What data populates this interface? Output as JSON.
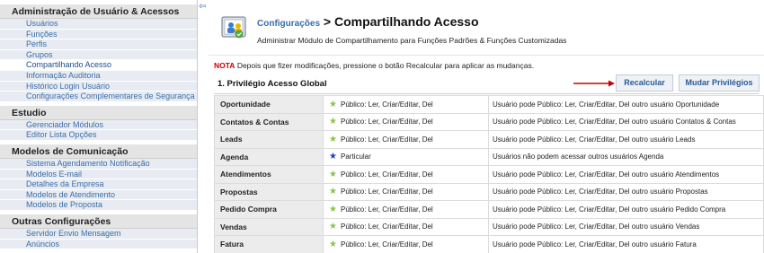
{
  "sidebar": {
    "sections": [
      {
        "title": "Administração de Usuário & Acessos",
        "items": [
          {
            "label": "Usuários",
            "active": false
          },
          {
            "label": "Funções",
            "active": false
          },
          {
            "label": "Perfis",
            "active": false
          },
          {
            "label": "Grupos",
            "active": false
          },
          {
            "label": "Compartilhando Acesso",
            "active": true
          },
          {
            "label": "Informação Auditoria",
            "active": false
          },
          {
            "label": "Histórico Login Usuário",
            "active": false
          },
          {
            "label": "Configurações Complementares de Segurança",
            "active": false
          }
        ]
      },
      {
        "title": "Estudio",
        "items": [
          {
            "label": "Gerenciador Módulos",
            "active": false
          },
          {
            "label": "Editor Lista Opções",
            "active": false
          }
        ]
      },
      {
        "title": "Modelos de Comunicação",
        "items": [
          {
            "label": "Sistema Agendamento Notificação",
            "active": false
          },
          {
            "label": "Modelos E-mail",
            "active": false
          },
          {
            "label": "Detalhes da Empresa",
            "active": false
          },
          {
            "label": "Modelos de Atendimento",
            "active": false
          },
          {
            "label": "Modelos de Proposta",
            "active": false
          }
        ]
      },
      {
        "title": "Outras Configurações",
        "items": [
          {
            "label": "Servidor Envio Mensagem",
            "active": false
          },
          {
            "label": "Anúncios",
            "active": false
          }
        ]
      }
    ]
  },
  "header": {
    "breadcrumb_link": "Configurações",
    "breadcrumb_sep": " > ",
    "title": "Compartilhando Acesso",
    "subtitle": "Administrar Módulo de Compartilhamento para Funções Padrões & Funções Customizadas"
  },
  "note": {
    "label": "NOTA",
    "text": " Depois que fizer modificações, pressione o botão Recalcular para aplicar as mudanças."
  },
  "section": {
    "title": "1. Privilégio Acesso Global",
    "recalc_label": "Recalcular",
    "change_label": "Mudar Privilégios"
  },
  "colors": {
    "star_public": "#8bc34a",
    "star_private": "#1f3fbf",
    "note_red": "#cc0000",
    "arrow_red": "#cc0000"
  },
  "rows": [
    {
      "module": "Oportunidade",
      "icon": "green-star-icon",
      "permission": "Público: Ler, Criar/Editar, Del",
      "description": "Usuário pode Público: Ler, Criar/Editar, Del outro usuário Oportunidade"
    },
    {
      "module": "Contatos & Contas",
      "icon": "green-star-icon",
      "permission": "Público: Ler, Criar/Editar, Del",
      "description": "Usuário pode Público: Ler, Criar/Editar, Del outro usuário Contatos & Contas"
    },
    {
      "module": "Leads",
      "icon": "green-star-icon",
      "permission": "Público: Ler, Criar/Editar, Del",
      "description": "Usuário pode Público: Ler, Criar/Editar, Del outro usuário Leads"
    },
    {
      "module": "Agenda",
      "icon": "blue-star-icon",
      "permission": "Particular",
      "description": "Usuários não podem acessar outros usuários Agenda"
    },
    {
      "module": "Atendimentos",
      "icon": "green-star-icon",
      "permission": "Público: Ler, Criar/Editar, Del",
      "description": "Usuário pode Público: Ler, Criar/Editar, Del outro usuário Atendimentos"
    },
    {
      "module": "Propostas",
      "icon": "green-star-icon",
      "permission": "Público: Ler, Criar/Editar, Del",
      "description": "Usuário pode Público: Ler, Criar/Editar, Del outro usuário Propostas"
    },
    {
      "module": "Pedido Compra",
      "icon": "green-star-icon",
      "permission": "Público: Ler, Criar/Editar, Del",
      "description": "Usuário pode Público: Ler, Criar/Editar, Del outro usuário Pedido Compra"
    },
    {
      "module": "Vendas",
      "icon": "green-star-icon",
      "permission": "Público: Ler, Criar/Editar, Del",
      "description": "Usuário pode Público: Ler, Criar/Editar, Del outro usuário Vendas"
    },
    {
      "module": "Fatura",
      "icon": "green-star-icon",
      "permission": "Público: Ler, Criar/Editar, Del",
      "description": "Usuário pode Público: Ler, Criar/Editar, Del outro usuário Fatura"
    }
  ]
}
